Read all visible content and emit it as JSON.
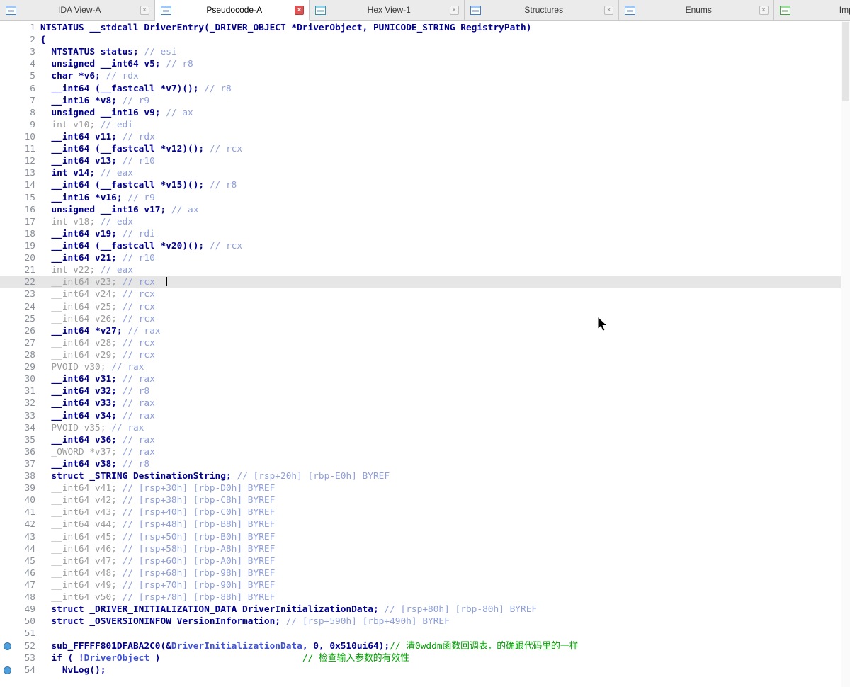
{
  "colors": {
    "keyword": "#000091",
    "muted": "#9b9b9b",
    "comment": "#8e9fd8",
    "user_comment": "#00a000",
    "variable": "#4053d8",
    "highlight_row": "#e6e6e6",
    "line_number": "#888f99",
    "marker_dot": "#4d9fdd",
    "tab_close_active": "#e05252"
  },
  "icons": {
    "close": "×"
  },
  "tabs": [
    {
      "label": "IDA View-A",
      "icon": "ida-view-icon",
      "frame": "#4a7ebb",
      "header": "#aac6e4",
      "active": false
    },
    {
      "label": "Pseudocode-A",
      "icon": "pseudocode-icon",
      "frame": "#4a7ebb",
      "header": "#aac6e4",
      "active": true
    },
    {
      "label": "Hex View-1",
      "icon": "hex-view-icon",
      "frame": "#3f8fa8",
      "header": "#9fd0de",
      "active": false
    },
    {
      "label": "Structures",
      "icon": "structures-icon",
      "frame": "#4a7ebb",
      "header": "#aac6e4",
      "active": false
    },
    {
      "label": "Enums",
      "icon": "enums-icon",
      "frame": "#4a7ebb",
      "header": "#aac6e4",
      "active": false
    },
    {
      "label": "Imports",
      "icon": "imports-icon",
      "frame": "#4aa04a",
      "header": "#a8d4a8",
      "active": false
    }
  ],
  "code": {
    "lines": [
      {
        "n": 1,
        "s": [
          {
            "t": "NTSTATUS __stdcall DriverEntry(_DRIVER_OBJECT *DriverObject, PUNICODE_STRING RegistryPath)",
            "c": "k"
          }
        ]
      },
      {
        "n": 2,
        "s": [
          {
            "t": "{",
            "c": "k"
          }
        ]
      },
      {
        "n": 3,
        "s": [
          {
            "t": "  NTSTATUS status; ",
            "c": "k"
          },
          {
            "t": "// esi",
            "c": "c"
          }
        ]
      },
      {
        "n": 4,
        "s": [
          {
            "t": "  unsigned __int64 v5; ",
            "c": "k"
          },
          {
            "t": "// r8",
            "c": "c"
          }
        ]
      },
      {
        "n": 5,
        "s": [
          {
            "t": "  char *v6; ",
            "c": "k"
          },
          {
            "t": "// rdx",
            "c": "c"
          }
        ]
      },
      {
        "n": 6,
        "s": [
          {
            "t": "  __int64 (__fastcall *v7)(); ",
            "c": "k"
          },
          {
            "t": "// r8",
            "c": "c"
          }
        ]
      },
      {
        "n": 7,
        "s": [
          {
            "t": "  __int16 *v8; ",
            "c": "k"
          },
          {
            "t": "// r9",
            "c": "c"
          }
        ]
      },
      {
        "n": 8,
        "s": [
          {
            "t": "  unsigned __int16 v9; ",
            "c": "k"
          },
          {
            "t": "// ax",
            "c": "c"
          }
        ]
      },
      {
        "n": 9,
        "s": [
          {
            "t": "  int v10; ",
            "c": "g"
          },
          {
            "t": "// edi",
            "c": "c"
          }
        ]
      },
      {
        "n": 10,
        "s": [
          {
            "t": "  __int64 v11; ",
            "c": "k"
          },
          {
            "t": "// rdx",
            "c": "c"
          }
        ]
      },
      {
        "n": 11,
        "s": [
          {
            "t": "  __int64 (__fastcall *v12)(); ",
            "c": "k"
          },
          {
            "t": "// rcx",
            "c": "c"
          }
        ]
      },
      {
        "n": 12,
        "s": [
          {
            "t": "  __int64 v13; ",
            "c": "k"
          },
          {
            "t": "// r10",
            "c": "c"
          }
        ]
      },
      {
        "n": 13,
        "s": [
          {
            "t": "  int v14; ",
            "c": "k"
          },
          {
            "t": "// eax",
            "c": "c"
          }
        ]
      },
      {
        "n": 14,
        "s": [
          {
            "t": "  __int64 (__fastcall *v15)(); ",
            "c": "k"
          },
          {
            "t": "// r8",
            "c": "c"
          }
        ]
      },
      {
        "n": 15,
        "s": [
          {
            "t": "  __int16 *v16; ",
            "c": "k"
          },
          {
            "t": "// r9",
            "c": "c"
          }
        ]
      },
      {
        "n": 16,
        "s": [
          {
            "t": "  unsigned __int16 v17; ",
            "c": "k"
          },
          {
            "t": "// ax",
            "c": "c"
          }
        ]
      },
      {
        "n": 17,
        "s": [
          {
            "t": "  int v18; ",
            "c": "g"
          },
          {
            "t": "// edx",
            "c": "c"
          }
        ]
      },
      {
        "n": 18,
        "s": [
          {
            "t": "  __int64 v19; ",
            "c": "k"
          },
          {
            "t": "// rdi",
            "c": "c"
          }
        ]
      },
      {
        "n": 19,
        "s": [
          {
            "t": "  __int64 (__fastcall *v20)(); ",
            "c": "k"
          },
          {
            "t": "// rcx",
            "c": "c"
          }
        ]
      },
      {
        "n": 20,
        "s": [
          {
            "t": "  __int64 v21; ",
            "c": "k"
          },
          {
            "t": "// r10",
            "c": "c"
          }
        ]
      },
      {
        "n": 21,
        "s": [
          {
            "t": "  int v22; ",
            "c": "g"
          },
          {
            "t": "// eax",
            "c": "c"
          }
        ]
      },
      {
        "n": 22,
        "hl": true,
        "caret": true,
        "s": [
          {
            "t": "  __int64 v23; ",
            "c": "g"
          },
          {
            "t": "// rcx",
            "c": "c"
          },
          {
            "t": "  ",
            "c": "p"
          }
        ]
      },
      {
        "n": 23,
        "s": [
          {
            "t": "  __int64 v24; ",
            "c": "g"
          },
          {
            "t": "// rcx",
            "c": "c"
          }
        ]
      },
      {
        "n": 24,
        "s": [
          {
            "t": "  __int64 v25; ",
            "c": "g"
          },
          {
            "t": "// rcx",
            "c": "c"
          }
        ]
      },
      {
        "n": 25,
        "s": [
          {
            "t": "  __int64 v26; ",
            "c": "g"
          },
          {
            "t": "// rcx",
            "c": "c"
          }
        ]
      },
      {
        "n": 26,
        "s": [
          {
            "t": "  __int64 *v27; ",
            "c": "k"
          },
          {
            "t": "// rax",
            "c": "c"
          }
        ]
      },
      {
        "n": 27,
        "s": [
          {
            "t": "  __int64 v28; ",
            "c": "g"
          },
          {
            "t": "// rcx",
            "c": "c"
          }
        ]
      },
      {
        "n": 28,
        "s": [
          {
            "t": "  __int64 v29; ",
            "c": "g"
          },
          {
            "t": "// rcx",
            "c": "c"
          }
        ]
      },
      {
        "n": 29,
        "s": [
          {
            "t": "  PVOID v30; ",
            "c": "g"
          },
          {
            "t": "// rax",
            "c": "c"
          }
        ]
      },
      {
        "n": 30,
        "s": [
          {
            "t": "  __int64 v31; ",
            "c": "k"
          },
          {
            "t": "// rax",
            "c": "c"
          }
        ]
      },
      {
        "n": 31,
        "s": [
          {
            "t": "  __int64 v32; ",
            "c": "k"
          },
          {
            "t": "// r8",
            "c": "c"
          }
        ]
      },
      {
        "n": 32,
        "s": [
          {
            "t": "  __int64 v33; ",
            "c": "k"
          },
          {
            "t": "// rax",
            "c": "c"
          }
        ]
      },
      {
        "n": 33,
        "s": [
          {
            "t": "  __int64 v34; ",
            "c": "k"
          },
          {
            "t": "// rax",
            "c": "c"
          }
        ]
      },
      {
        "n": 34,
        "s": [
          {
            "t": "  PVOID v35; ",
            "c": "g"
          },
          {
            "t": "// rax",
            "c": "c"
          }
        ]
      },
      {
        "n": 35,
        "s": [
          {
            "t": "  __int64 v36; ",
            "c": "k"
          },
          {
            "t": "// rax",
            "c": "c"
          }
        ]
      },
      {
        "n": 36,
        "s": [
          {
            "t": "  _OWORD *v37; ",
            "c": "g"
          },
          {
            "t": "// rax",
            "c": "c"
          }
        ]
      },
      {
        "n": 37,
        "s": [
          {
            "t": "  __int64 v38; ",
            "c": "k"
          },
          {
            "t": "// r8",
            "c": "c"
          }
        ]
      },
      {
        "n": 38,
        "s": [
          {
            "t": "  struct _STRING DestinationString; ",
            "c": "k"
          },
          {
            "t": "// [rsp+20h] [rbp-E0h] BYREF",
            "c": "c"
          }
        ]
      },
      {
        "n": 39,
        "s": [
          {
            "t": "  __int64 v41; ",
            "c": "g"
          },
          {
            "t": "// [rsp+30h] [rbp-D0h] BYREF",
            "c": "c"
          }
        ]
      },
      {
        "n": 40,
        "s": [
          {
            "t": "  __int64 v42; ",
            "c": "g"
          },
          {
            "t": "// [rsp+38h] [rbp-C8h] BYREF",
            "c": "c"
          }
        ]
      },
      {
        "n": 41,
        "s": [
          {
            "t": "  __int64 v43; ",
            "c": "g"
          },
          {
            "t": "// [rsp+40h] [rbp-C0h] BYREF",
            "c": "c"
          }
        ]
      },
      {
        "n": 42,
        "s": [
          {
            "t": "  __int64 v44; ",
            "c": "g"
          },
          {
            "t": "// [rsp+48h] [rbp-B8h] BYREF",
            "c": "c"
          }
        ]
      },
      {
        "n": 43,
        "s": [
          {
            "t": "  __int64 v45; ",
            "c": "g"
          },
          {
            "t": "// [rsp+50h] [rbp-B0h] BYREF",
            "c": "c"
          }
        ]
      },
      {
        "n": 44,
        "s": [
          {
            "t": "  __int64 v46; ",
            "c": "g"
          },
          {
            "t": "// [rsp+58h] [rbp-A8h] BYREF",
            "c": "c"
          }
        ]
      },
      {
        "n": 45,
        "s": [
          {
            "t": "  __int64 v47; ",
            "c": "g"
          },
          {
            "t": "// [rsp+60h] [rbp-A0h] BYREF",
            "c": "c"
          }
        ]
      },
      {
        "n": 46,
        "s": [
          {
            "t": "  __int64 v48; ",
            "c": "g"
          },
          {
            "t": "// [rsp+68h] [rbp-98h] BYREF",
            "c": "c"
          }
        ]
      },
      {
        "n": 47,
        "s": [
          {
            "t": "  __int64 v49; ",
            "c": "g"
          },
          {
            "t": "// [rsp+70h] [rbp-90h] BYREF",
            "c": "c"
          }
        ]
      },
      {
        "n": 48,
        "s": [
          {
            "t": "  __int64 v50; ",
            "c": "g"
          },
          {
            "t": "// [rsp+78h] [rbp-88h] BYREF",
            "c": "c"
          }
        ]
      },
      {
        "n": 49,
        "s": [
          {
            "t": "  struct _DRIVER_INITIALIZATION_DATA DriverInitializationData; ",
            "c": "k"
          },
          {
            "t": "// [rsp+80h] [rbp-80h] BYREF",
            "c": "c"
          }
        ]
      },
      {
        "n": 50,
        "s": [
          {
            "t": "  struct _OSVERSIONINFOW VersionInformation; ",
            "c": "k"
          },
          {
            "t": "// [rsp+590h] [rbp+490h] BYREF",
            "c": "c"
          }
        ]
      },
      {
        "n": 51,
        "s": []
      },
      {
        "n": 52,
        "dot": true,
        "s": [
          {
            "t": "  sub_FFFFF801DFABA2C0(&",
            "c": "k"
          },
          {
            "t": "DriverInitializationData",
            "c": "v"
          },
          {
            "t": ", 0, 0x510ui64);",
            "c": "k"
          },
          {
            "t": "// 清0wddm函数回调表，的确跟代码里的一样",
            "c": "n"
          }
        ]
      },
      {
        "n": 53,
        "s": [
          {
            "t": "  if ( !",
            "c": "k"
          },
          {
            "t": "DriverObject",
            "c": "v"
          },
          {
            "t": " )",
            "c": "k"
          },
          {
            "t": "                          ",
            "c": "p"
          },
          {
            "t": "// 检查输入参数的有效性",
            "c": "n"
          }
        ]
      },
      {
        "n": 54,
        "dot": true,
        "s": [
          {
            "t": "    NvLog();",
            "c": "k"
          }
        ]
      }
    ]
  }
}
